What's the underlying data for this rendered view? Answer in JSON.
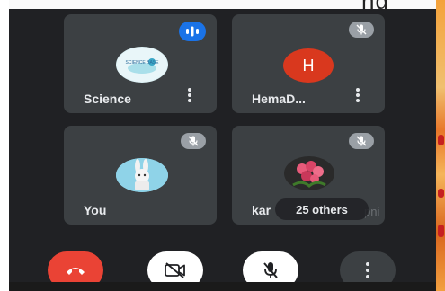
{
  "header": {
    "cropped_text": "ng"
  },
  "tiles": [
    {
      "name": "Science",
      "avatar_text": "SCIENCE BASE",
      "status": "speaking"
    },
    {
      "name": "HemaD...",
      "avatar_initial": "H",
      "status": "muted"
    },
    {
      "name": "You",
      "status": "muted"
    },
    {
      "name": "kar",
      "status": "muted",
      "name_overlay": "pni"
    }
  ],
  "others": {
    "label": "25 others"
  },
  "controls": {
    "end_call": "phone-hangup-icon",
    "camera": "video-off-icon",
    "mic": "mic-off-icon",
    "more": "more-vert-icon"
  },
  "colors": {
    "background": "#202124",
    "tile": "#3c4043",
    "end_call": "#ea4335",
    "speaking": "#1a73e8",
    "avatar_h": "#d9381e"
  }
}
